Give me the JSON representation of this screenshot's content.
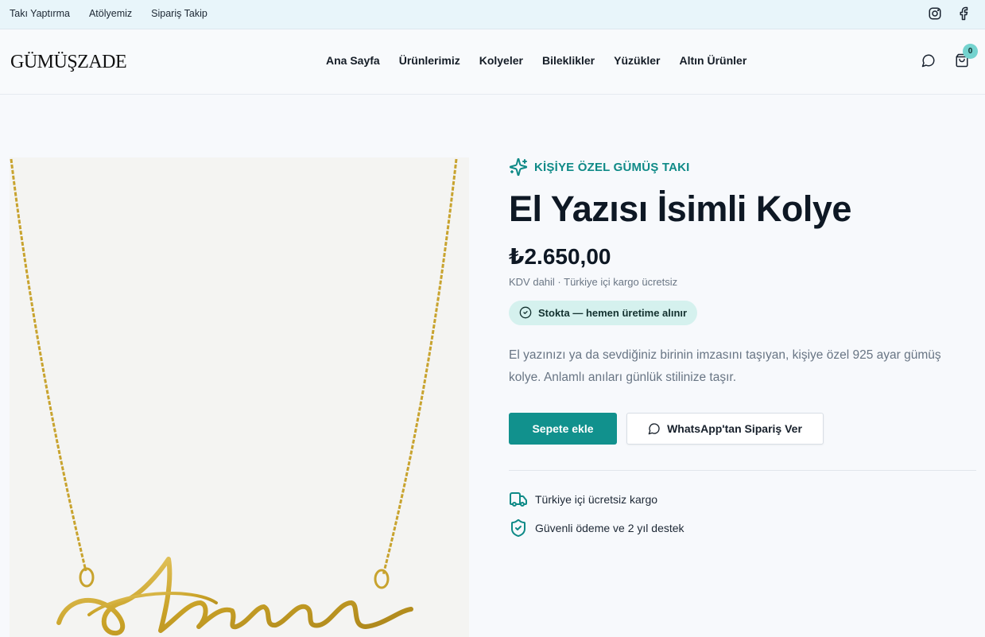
{
  "topbar": {
    "links": [
      "Takı Yaptırma",
      "Atölyemiz",
      "Sipariş Takip"
    ],
    "social_icons": [
      "instagram-icon",
      "facebook-icon"
    ]
  },
  "header": {
    "logo": "GÜMÜŞZADE",
    "nav": [
      "Ana Sayfa",
      "Ürünlerimiz",
      "Kolyeler",
      "Bileklikler",
      "Yüzükler",
      "Altın Ürünler"
    ],
    "cart_count": "0",
    "icons": [
      "chat-icon",
      "shopping-bag-icon"
    ]
  },
  "product": {
    "eyebrow": "KİŞİYE ÖZEL GÜMÜŞ TAKI",
    "title": "El Yazısı İsimli Kolye",
    "price": "₺2.650,00",
    "price_note": "KDV dahil · Türkiye içi kargo ücretsiz",
    "stock_label": "Stokta — hemen üretime alınır",
    "description": "El yazınızı ya da sevdiğiniz birinin imzasını taşıyan, kişiye özel 925 ayar gümüş kolye. Anlamlı anıları günlük stilinize taşır.",
    "add_to_cart": "Sepete ekle",
    "whatsapp_order": "WhatsApp'tan Sipariş Ver",
    "features": [
      {
        "icon": "truck-icon",
        "label": "Türkiye içi ücretsiz kargo"
      },
      {
        "icon": "shield-check-icon",
        "label": "Güvenli ödeme ve 2 yıl destek"
      }
    ],
    "pendant_name": "Ariana"
  },
  "colors": {
    "accent": "#11918d",
    "accent_light": "#d5f1ee",
    "topbar_bg": "#e8f5fa",
    "gold": "#c9a227"
  }
}
